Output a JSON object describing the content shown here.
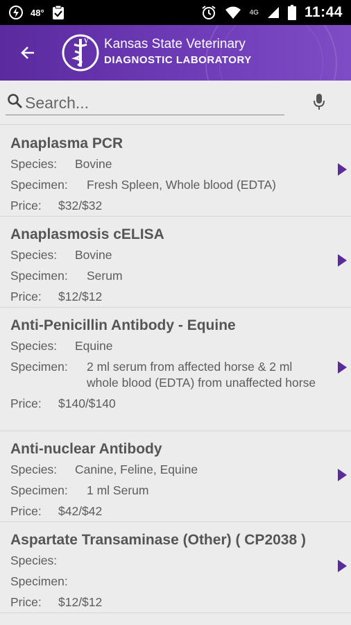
{
  "status_bar": {
    "temperature": "48°",
    "network": "4G",
    "time": "11:44"
  },
  "header": {
    "brand_line1": "Kansas State Veterinary",
    "brand_line2": "DIAGNOSTIC LABORATORY",
    "accent_color": "#6a35b2"
  },
  "search": {
    "placeholder": "Search..."
  },
  "labels": {
    "species": "Species:",
    "specimen": "Specimen:",
    "price": "Price:"
  },
  "tests": [
    {
      "name": "Anaplasma PCR",
      "species": "Bovine",
      "specimen": "Fresh Spleen, Whole blood (EDTA)",
      "price": "$32/$32"
    },
    {
      "name": "Anaplasmosis cELISA",
      "species": "Bovine",
      "specimen": "Serum",
      "price": "$12/$12"
    },
    {
      "name": "Anti-Penicillin Antibody - Equine",
      "species": "Equine",
      "specimen": "2 ml serum from affected horse & 2 ml whole blood (EDTA) from unaffected horse",
      "price": "$140/$140"
    },
    {
      "name": "Anti-nuclear Antibody",
      "species": "Canine, Feline, Equine",
      "specimen": "1 ml Serum",
      "price": "$42/$42"
    },
    {
      "name": "Aspartate Transaminase (Other) ( CP2038 )",
      "species": "",
      "specimen": "",
      "price": "$12/$12"
    }
  ]
}
